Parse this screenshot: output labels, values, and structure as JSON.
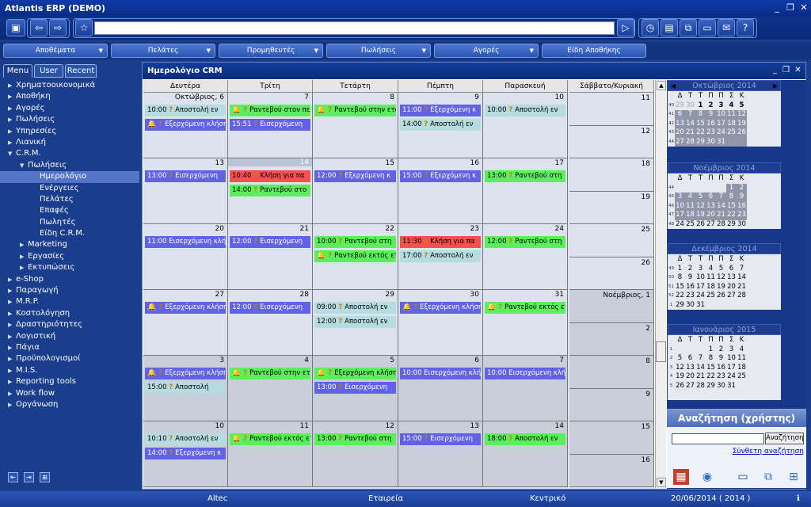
{
  "app_title": "Atlantis ERP (DEMO)",
  "window_controls": {
    "minimize": "_",
    "restore": "❐",
    "close": "✕"
  },
  "menu": [
    {
      "label": "Αποθέματα"
    },
    {
      "label": "Πελάτες"
    },
    {
      "label": "Προμηθευτές"
    },
    {
      "label": "Πωλήσεις"
    },
    {
      "label": "Αγορές"
    },
    {
      "label": "Είδη Αποθήκης"
    }
  ],
  "left_tabs": [
    "Menu",
    "User",
    "Recent"
  ],
  "tree": [
    {
      "label": "Χρηματοοικονομικά",
      "level": 0,
      "tw": "▶"
    },
    {
      "label": "Αποθήκη",
      "level": 0,
      "tw": "▶"
    },
    {
      "label": "Αγορές",
      "level": 0,
      "tw": "▶"
    },
    {
      "label": "Πωλήσεις",
      "level": 0,
      "tw": "▶"
    },
    {
      "label": "Υπηρεσίες",
      "level": 0,
      "tw": "▶"
    },
    {
      "label": "Λιανική",
      "level": 0,
      "tw": "▶"
    },
    {
      "label": "C.R.M.",
      "level": 0,
      "tw": "▼"
    },
    {
      "label": "Πωλήσεις",
      "level": 1,
      "tw": "▼"
    },
    {
      "label": "Ημερολόγιο",
      "level": 2,
      "tw": "",
      "selected": true
    },
    {
      "label": "Ενέργειες",
      "level": 2,
      "tw": ""
    },
    {
      "label": "Πελάτες",
      "level": 2,
      "tw": ""
    },
    {
      "label": "Επαφές",
      "level": 2,
      "tw": ""
    },
    {
      "label": "Πωλητές",
      "level": 2,
      "tw": ""
    },
    {
      "label": "Είδη C.R.M.",
      "level": 2,
      "tw": ""
    },
    {
      "label": "Marketing",
      "level": 1,
      "tw": "▶"
    },
    {
      "label": "Εργασίες",
      "level": 1,
      "tw": "▶"
    },
    {
      "label": "Εκτυπώσεις",
      "level": 1,
      "tw": "▶"
    },
    {
      "label": "e-Shop",
      "level": 0,
      "tw": "▶"
    },
    {
      "label": "Παραγωγή",
      "level": 0,
      "tw": "▶"
    },
    {
      "label": "M.R.P.",
      "level": 0,
      "tw": "▶"
    },
    {
      "label": "Κοστολόγηση",
      "level": 0,
      "tw": "▶"
    },
    {
      "label": "Δραστηριότητες",
      "level": 0,
      "tw": "▶"
    },
    {
      "label": "Λογιστική",
      "level": 0,
      "tw": "▶"
    },
    {
      "label": "Πάγια",
      "level": 0,
      "tw": "▶"
    },
    {
      "label": "Προϋπολογισμοί",
      "level": 0,
      "tw": "▶"
    },
    {
      "label": "M.I.S.",
      "level": 0,
      "tw": "▶"
    },
    {
      "label": "Reporting tools",
      "level": 0,
      "tw": "▶"
    },
    {
      "label": "Work flow",
      "level": 0,
      "tw": "▶"
    },
    {
      "label": "Οργάνωση",
      "level": 0,
      "tw": "▶"
    }
  ],
  "calendar_title": "Ημερολόγιο CRM",
  "weekdays": [
    "Δευτέρα",
    "Τρίτη",
    "Τετάρτη",
    "Πέμπτη",
    "Παρασκευή",
    "Σάββατο/Κυριακή"
  ],
  "weeks": [
    {
      "days": [
        {
          "label": "Οκτώβριος, 6",
          "events": [
            {
              "t": "10:00",
              "icons": "q",
              "text": "Αποστολή εν",
              "c": "teal"
            },
            {
              "t": "",
              "icons": "bq",
              "text": "Εξερχόμενη κλήση",
              "c": "blue"
            }
          ]
        },
        {
          "label": "7",
          "events": [
            {
              "t": "",
              "icons": "bq",
              "text": "Ραντεβού στον πελ",
              "c": "green"
            },
            {
              "t": "15:51",
              "icons": "q",
              "text": "Εισερχόμενη",
              "c": "blue"
            }
          ]
        },
        {
          "label": "8",
          "events": [
            {
              "t": "",
              "icons": "bq",
              "text": "Ραντεβού στην ετα",
              "c": "green"
            }
          ]
        },
        {
          "label": "9",
          "events": [
            {
              "t": "11:00",
              "icons": "q",
              "text": "Εξερχόμενη κ",
              "c": "blue"
            },
            {
              "t": "14:00",
              "icons": "q",
              "text": "Αποστολή εν",
              "c": "teal"
            }
          ]
        },
        {
          "label": "10",
          "events": [
            {
              "t": "10:00",
              "icons": "q",
              "text": "Αποστολή εν",
              "c": "teal"
            }
          ]
        }
      ],
      "weekend": [
        "11",
        "12"
      ]
    },
    {
      "days": [
        {
          "label": "13",
          "events": [
            {
              "t": "13:00",
              "icons": "q",
              "text": "Εισερχόμενη",
              "c": "blue"
            }
          ]
        },
        {
          "label": "14",
          "today": true,
          "events": [
            {
              "t": "10:40",
              "icons": "q",
              "text": "Κλήση για πα",
              "c": "red"
            },
            {
              "t": "14:00",
              "icons": "q",
              "text": "Ραντεβού στο",
              "c": "green"
            }
          ]
        },
        {
          "label": "15",
          "events": [
            {
              "t": "12:00",
              "icons": "q",
              "text": "Εξερχόμενη κ",
              "c": "blue"
            }
          ]
        },
        {
          "label": "16",
          "events": [
            {
              "t": "15:00",
              "icons": "q",
              "text": "Εξερχόμενη κ",
              "c": "blue"
            }
          ]
        },
        {
          "label": "17",
          "events": [
            {
              "t": "13:00",
              "icons": "q",
              "text": "Ραντεβού στη",
              "c": "green"
            }
          ]
        }
      ],
      "weekend": [
        "18",
        "19"
      ]
    },
    {
      "days": [
        {
          "label": "20",
          "events": [
            {
              "t": "11:00",
              "icons": "",
              "text": "Εισερχόμενη κλήσ",
              "c": "blue"
            }
          ]
        },
        {
          "label": "21",
          "events": [
            {
              "t": "12:00",
              "icons": "q",
              "text": "Εισερχόμενη",
              "c": "blue"
            }
          ]
        },
        {
          "label": "22",
          "events": [
            {
              "t": "10:00",
              "icons": "q",
              "text": "Ραντεβού στη",
              "c": "green"
            },
            {
              "t": "",
              "icons": "bq",
              "text": "Ραντεβού εκτός ετ",
              "c": "green"
            }
          ]
        },
        {
          "label": "23",
          "events": [
            {
              "t": "11:30",
              "icons": "q",
              "text": "Κλήση για πα",
              "c": "red"
            },
            {
              "t": "17:00",
              "icons": "q",
              "text": "Αποστολή εν",
              "c": "teal"
            }
          ]
        },
        {
          "label": "24",
          "events": [
            {
              "t": "12:00",
              "icons": "q",
              "text": "Ραντεβού στη",
              "c": "green"
            }
          ]
        }
      ],
      "weekend": [
        "25",
        "26"
      ]
    },
    {
      "days": [
        {
          "label": "27",
          "events": [
            {
              "t": "",
              "icons": "bq",
              "text": "Εξερχόμενη κλήση",
              "c": "blue"
            }
          ]
        },
        {
          "label": "28",
          "events": [
            {
              "t": "12:00",
              "icons": "q",
              "text": "Εισερχόμενη",
              "c": "blue"
            }
          ]
        },
        {
          "label": "29",
          "events": [
            {
              "t": "09:00",
              "icons": "q",
              "text": "Αποστολή εν",
              "c": "teal"
            },
            {
              "t": "12:00",
              "icons": "q",
              "text": "Αποστολή εν",
              "c": "teal"
            }
          ]
        },
        {
          "label": "30",
          "events": [
            {
              "t": "",
              "icons": "bq",
              "text": "Εξερχόμενη κλήση",
              "c": "blue"
            }
          ]
        },
        {
          "label": "31",
          "events": [
            {
              "t": "",
              "icons": "bq",
              "text": "Ραντεβού εκτός ετ",
              "c": "green"
            }
          ]
        }
      ],
      "weekend": [
        "Νοέμβριος, 1",
        "2"
      ],
      "weekend_gray": true
    },
    {
      "gray": true,
      "days": [
        {
          "label": "3",
          "events": [
            {
              "t": "",
              "icons": "bq",
              "text": "Εξερχόμενη κλήση",
              "c": "blue"
            },
            {
              "t": "15:00",
              "icons": "q",
              "text": "Αποστολή",
              "c": "teal"
            }
          ]
        },
        {
          "label": "4",
          "events": [
            {
              "t": "",
              "icons": "bq",
              "text": "Ραντεβού στην ετα",
              "c": "green"
            }
          ]
        },
        {
          "label": "5",
          "events": [
            {
              "t": "",
              "icons": "bq",
              "text": "Εξερχόμενη κλήση",
              "c": "green"
            },
            {
              "t": "13:00",
              "icons": "q",
              "text": "Εισερχόμενη",
              "c": "blue"
            }
          ]
        },
        {
          "label": "6",
          "events": [
            {
              "t": "10:00",
              "icons": "",
              "text": "Εισερχόμενη κλήσ",
              "c": "blue"
            }
          ]
        },
        {
          "label": "7",
          "events": [
            {
              "t": "10:00",
              "icons": "",
              "text": "Εισερχόμενη κλήσ",
              "c": "blue"
            }
          ]
        }
      ],
      "weekend": [
        "8",
        "9"
      ],
      "weekend_gray": true
    },
    {
      "gray": true,
      "days": [
        {
          "label": "10",
          "events": [
            {
              "t": "10:10",
              "icons": "q",
              "text": "Αποστολή εν",
              "c": "teal"
            },
            {
              "t": "14:00",
              "icons": "q",
              "text": "Εξερχόμενη κ",
              "c": "blue"
            }
          ]
        },
        {
          "label": "11",
          "events": [
            {
              "t": "",
              "icons": "bq",
              "text": "Ραντεβού εκτός ετ",
              "c": "green"
            }
          ]
        },
        {
          "label": "12",
          "events": [
            {
              "t": "13:00",
              "icons": "q",
              "text": "Ραντεβού στη",
              "c": "green"
            }
          ]
        },
        {
          "label": "13",
          "events": [
            {
              "t": "15:00",
              "icons": "q",
              "text": "Εισερχόμενη",
              "c": "blue"
            }
          ]
        },
        {
          "label": "14",
          "events": [
            {
              "t": "18:00",
              "icons": "q",
              "text": "Αποστολή εν",
              "c": "green"
            }
          ]
        }
      ],
      "weekend": [
        "15",
        "16"
      ],
      "weekend_gray": true
    }
  ],
  "mini_calendars": [
    {
      "title": "Οκτώβριος 2014",
      "nav": true,
      "rows": [
        [
          "40",
          "29",
          "30",
          "1",
          "2",
          "3",
          "4",
          "5"
        ],
        [
          "41",
          "6",
          "7",
          "8",
          "9",
          "10",
          "11",
          "12"
        ],
        [
          "42",
          "13",
          "14",
          "15",
          "16",
          "17",
          "18",
          "19"
        ],
        [
          "43",
          "20",
          "21",
          "22",
          "23",
          "24",
          "25",
          "26"
        ],
        [
          "44",
          "27",
          "28",
          "29",
          "30",
          "31",
          "",
          ""
        ]
      ]
    },
    {
      "title": "Νοέμβριος 2014",
      "rows": [
        [
          "44",
          "",
          "",
          "",
          "",
          "",
          "1",
          "2"
        ],
        [
          "45",
          "3",
          "4",
          "5",
          "6",
          "7",
          "8",
          "9"
        ],
        [
          "46",
          "10",
          "11",
          "12",
          "13",
          "14",
          "15",
          "16"
        ],
        [
          "47",
          "17",
          "18",
          "19",
          "20",
          "21",
          "22",
          "23"
        ],
        [
          "48",
          "24",
          "25",
          "26",
          "27",
          "28",
          "29",
          "30"
        ]
      ]
    },
    {
      "title": "Δεκέμβριος 2014",
      "rows": [
        [
          "49",
          "1",
          "2",
          "3",
          "4",
          "5",
          "6",
          "7"
        ],
        [
          "50",
          "8",
          "9",
          "10",
          "11",
          "12",
          "13",
          "14"
        ],
        [
          "51",
          "15",
          "16",
          "17",
          "18",
          "19",
          "20",
          "21"
        ],
        [
          "52",
          "22",
          "23",
          "24",
          "25",
          "26",
          "27",
          "28"
        ],
        [
          "1",
          "29",
          "30",
          "31",
          "",
          "",
          "",
          ""
        ]
      ]
    },
    {
      "title": "Ιανουάριος 2015",
      "rows": [
        [
          "1",
          "",
          "",
          "",
          "1",
          "2",
          "3",
          "4"
        ],
        [
          "2",
          "5",
          "6",
          "7",
          "8",
          "9",
          "10",
          "11"
        ],
        [
          "3",
          "12",
          "13",
          "14",
          "15",
          "16",
          "17",
          "18"
        ],
        [
          "4",
          "19",
          "20",
          "21",
          "22",
          "23",
          "24",
          "25"
        ],
        [
          "5",
          "26",
          "27",
          "28",
          "29",
          "30",
          "31",
          ""
        ],
        [
          "",
          "",
          "",
          "",
          "",
          "",
          "",
          ""
        ]
      ]
    }
  ],
  "mini_weekday_header": [
    "Δ",
    "Τ",
    "Τ",
    "Π",
    "Π",
    "Σ",
    "Κ"
  ],
  "search": {
    "title": "Αναζήτηση (χρήστης)",
    "button": "Αναζήτηση",
    "link": "Σύνθετη αναζήτηση",
    "placeholder": ""
  },
  "status": {
    "company": "Altec",
    "label1": "Εταιρεία",
    "label2": "Κεντρικό",
    "date": "20/06/2014 ( 2014 )"
  }
}
